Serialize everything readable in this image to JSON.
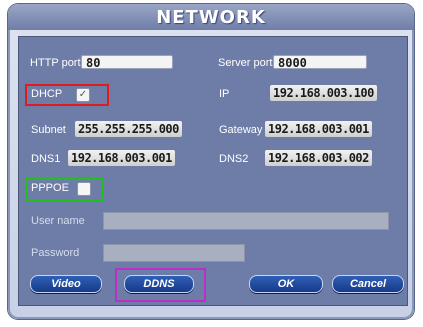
{
  "window": {
    "title": "NETWORK"
  },
  "fields": {
    "http_port": {
      "label": "HTTP port",
      "value": "80"
    },
    "server_port": {
      "label": "Server port",
      "value": "8000"
    },
    "dhcp": {
      "label": "DHCP",
      "checked": true,
      "mark": "✓"
    },
    "ip": {
      "label": "IP",
      "value": "192.168.003.100"
    },
    "subnet": {
      "label": "Subnet",
      "value": "255.255.255.000"
    },
    "gateway": {
      "label": "Gateway",
      "value": "192.168.003.001"
    },
    "dns1": {
      "label": "DNS1",
      "value": "192.168.003.001"
    },
    "dns2": {
      "label": "DNS2",
      "value": "192.168.003.002"
    },
    "pppoe": {
      "label": "PPPOE",
      "checked": false
    },
    "user_name": {
      "label": "User name",
      "value": ""
    },
    "password": {
      "label": "Password",
      "value": ""
    }
  },
  "buttons": {
    "video": "Video",
    "ddns": "DDNS",
    "ok": "OK",
    "cancel": "Cancel"
  },
  "colors": {
    "highlight_dhcp": "#e01b1b",
    "highlight_pppoe": "#22c01e",
    "highlight_ddns": "#c02cc7",
    "button_fill": "#1f4aa0"
  }
}
